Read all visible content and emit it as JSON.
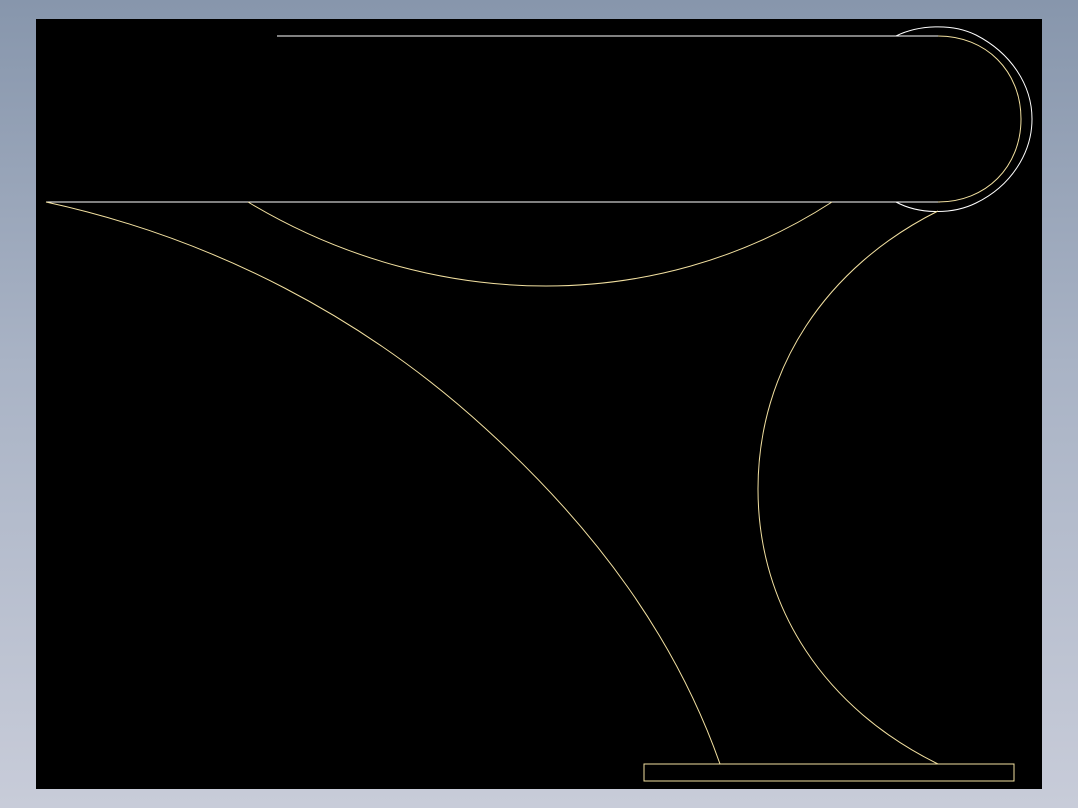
{
  "colors": {
    "background_gradient_top": "#8796ac",
    "background_gradient_bottom": "#c8ccd9",
    "canvas": "#000000",
    "line_white": "#ffffff",
    "line_yellow": "#f2e0a0"
  },
  "drawing": {
    "description_visible_text": ""
  }
}
